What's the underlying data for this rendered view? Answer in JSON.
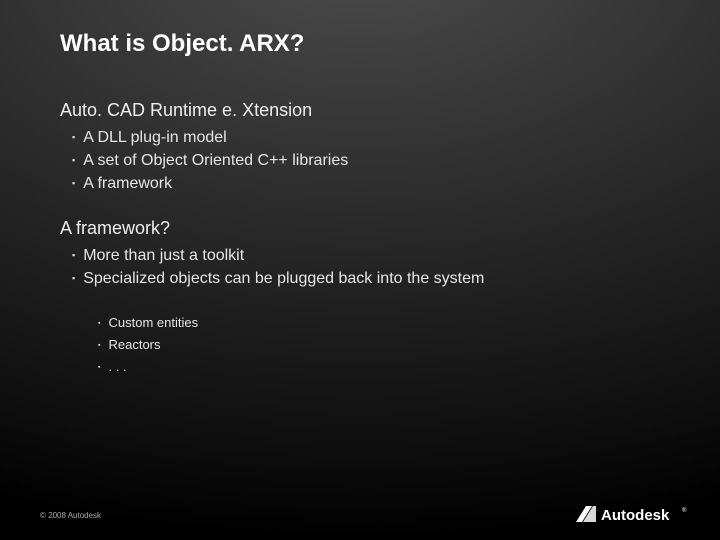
{
  "title": "What is Object. ARX?",
  "sections": [
    {
      "heading": "Auto. CAD Runtime e. Xtension",
      "items": [
        "A DLL plug-in model",
        "A set of Object Oriented C++ libraries",
        "A framework"
      ]
    },
    {
      "heading": "A framework?",
      "items": [
        "More than just a toolkit",
        "Specialized objects can be plugged back into the system"
      ],
      "subitems": [
        "Custom entities",
        "Reactors",
        ". . ."
      ]
    }
  ],
  "copyright": "© 2008 Autodesk",
  "logo_text": "Autodesk"
}
